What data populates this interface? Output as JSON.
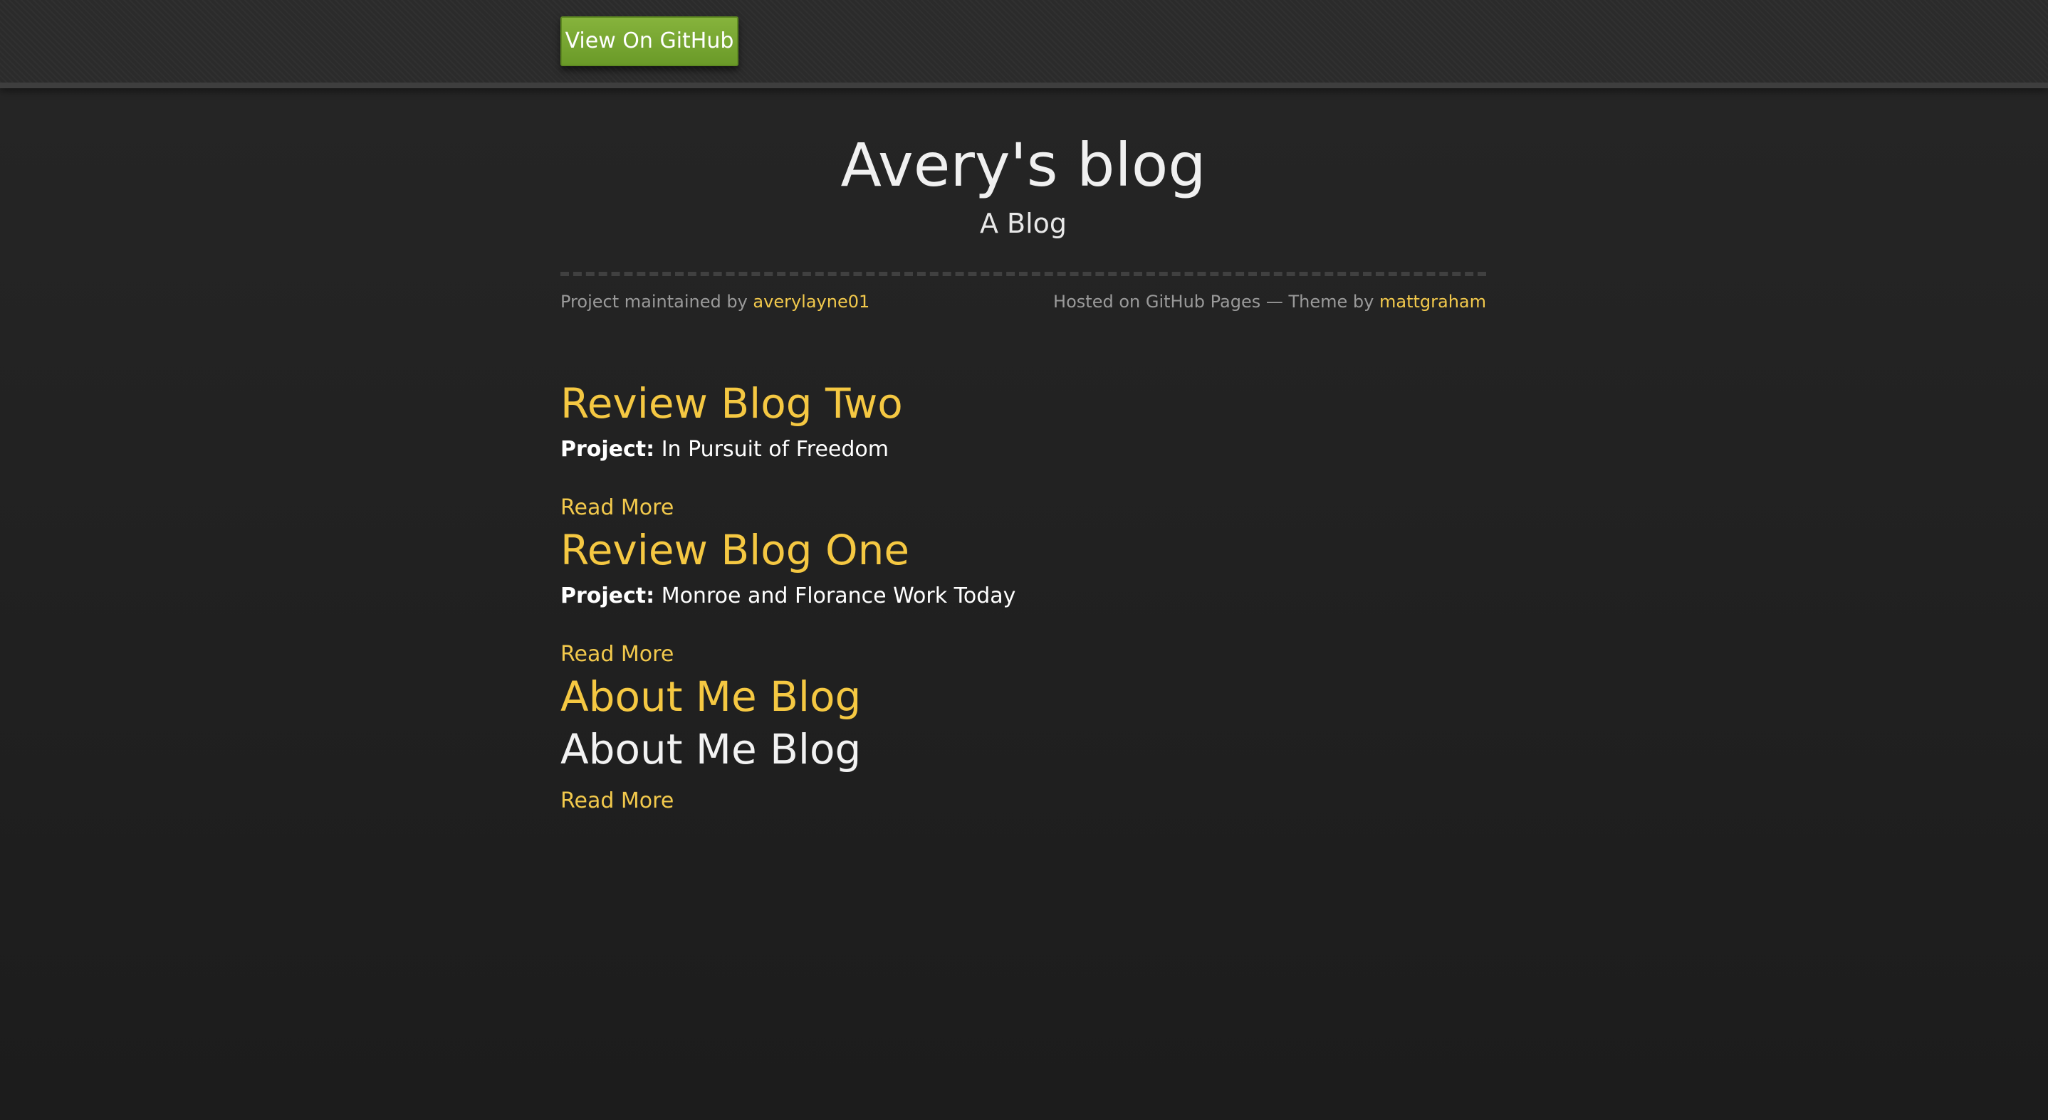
{
  "header": {
    "github_button_label": "View On GitHub"
  },
  "site": {
    "title": "Avery's blog",
    "subtitle": "A Blog"
  },
  "meta": {
    "maintained_prefix": "Project maintained by ",
    "maintainer": "averylayne01",
    "hosted_text": "Hosted on GitHub Pages — Theme by ",
    "theme_author": "mattgraham"
  },
  "posts": [
    {
      "title": "Review Blog Two",
      "project_label": "Project:",
      "project_value": " In Pursuit of Freedom",
      "read_more": "Read More"
    },
    {
      "title": "Review Blog One",
      "project_label": "Project:",
      "project_value": " Monroe and Florance Work Today",
      "read_more": "Read More"
    },
    {
      "title": "About Me Blog",
      "heading": "About Me Blog",
      "read_more": "Read More"
    }
  ],
  "colors": {
    "background": "#222222",
    "accent": "#f5c842",
    "github_button": "#76a832",
    "meta_text": "#9a9a9a"
  }
}
